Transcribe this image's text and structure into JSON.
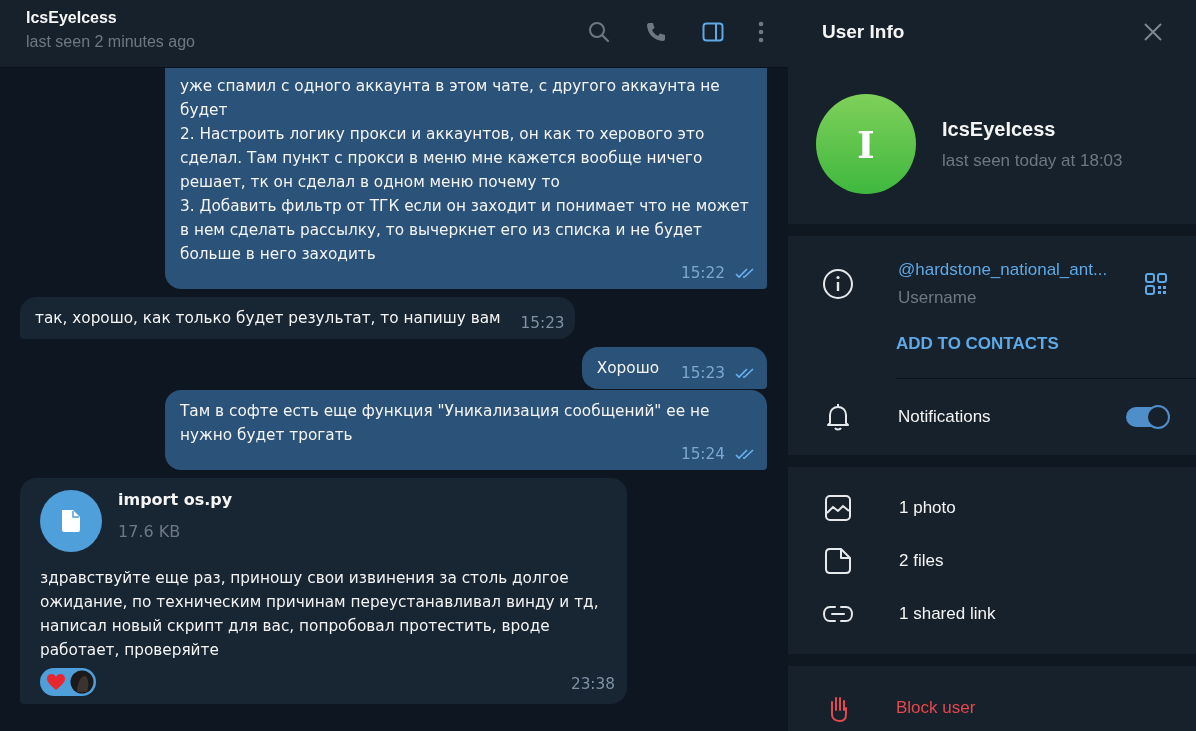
{
  "chat_header": {
    "title": "IcsEyeIcess",
    "status": "last seen 2 minutes ago"
  },
  "messages": [
    {
      "kind": "text",
      "outgoing": true,
      "read": true,
      "text": "уже спамил с одного аккаунта в этом чате, с другого аккаунта не будет\n2. Настроить логику прокси и аккаунтов, он как то херового это сделал. Там пункт с прокси в меню мне кажется вообще ничего решает, тк он сделал в одном меню почему то\n3. Добавить фильтр от ТГК если он заходит и понимает что не может в нем сделать рассылку, то вычеркнет его из списка и не будет больше в него заходить",
      "time": "15:22"
    },
    {
      "kind": "text",
      "outgoing": false,
      "text": "так, хорошо, как только будет результат, то напишу вам",
      "time": "15:23"
    },
    {
      "kind": "text",
      "outgoing": true,
      "read": true,
      "text": "Хорошо",
      "time": "15:23"
    },
    {
      "kind": "text",
      "outgoing": true,
      "read": true,
      "text": "Там в софте есть еще функция \"Уникализация сообщений\" ее не нужно будет трогать",
      "time": "15:24"
    },
    {
      "kind": "file",
      "outgoing": false,
      "file_name": "import os.py",
      "file_size": "17.6 KB",
      "text": "здравствуйте еще раз, приношу свои извинения за столь долгое ожидание, по техническим причинам переустанавливал винду и тд, написал новый скрипт для вас, попробовал протестить, вроде работает, проверяйте",
      "time": "23:38"
    }
  ],
  "user_info": {
    "title": "User Info",
    "avatar_letter": "I",
    "name": "IcsEyeIcess",
    "status": "last seen today at 18:03",
    "username": "@hardstone_national_ant...",
    "username_label": "Username",
    "add_contact": "ADD TO CONTACTS",
    "notifications": {
      "label": "Notifications",
      "on": true
    },
    "media": [
      {
        "kind": "photo",
        "label": "1 photo"
      },
      {
        "kind": "file",
        "label": "2 files"
      },
      {
        "kind": "link",
        "label": "1 shared link"
      }
    ],
    "block": "Block user"
  }
}
